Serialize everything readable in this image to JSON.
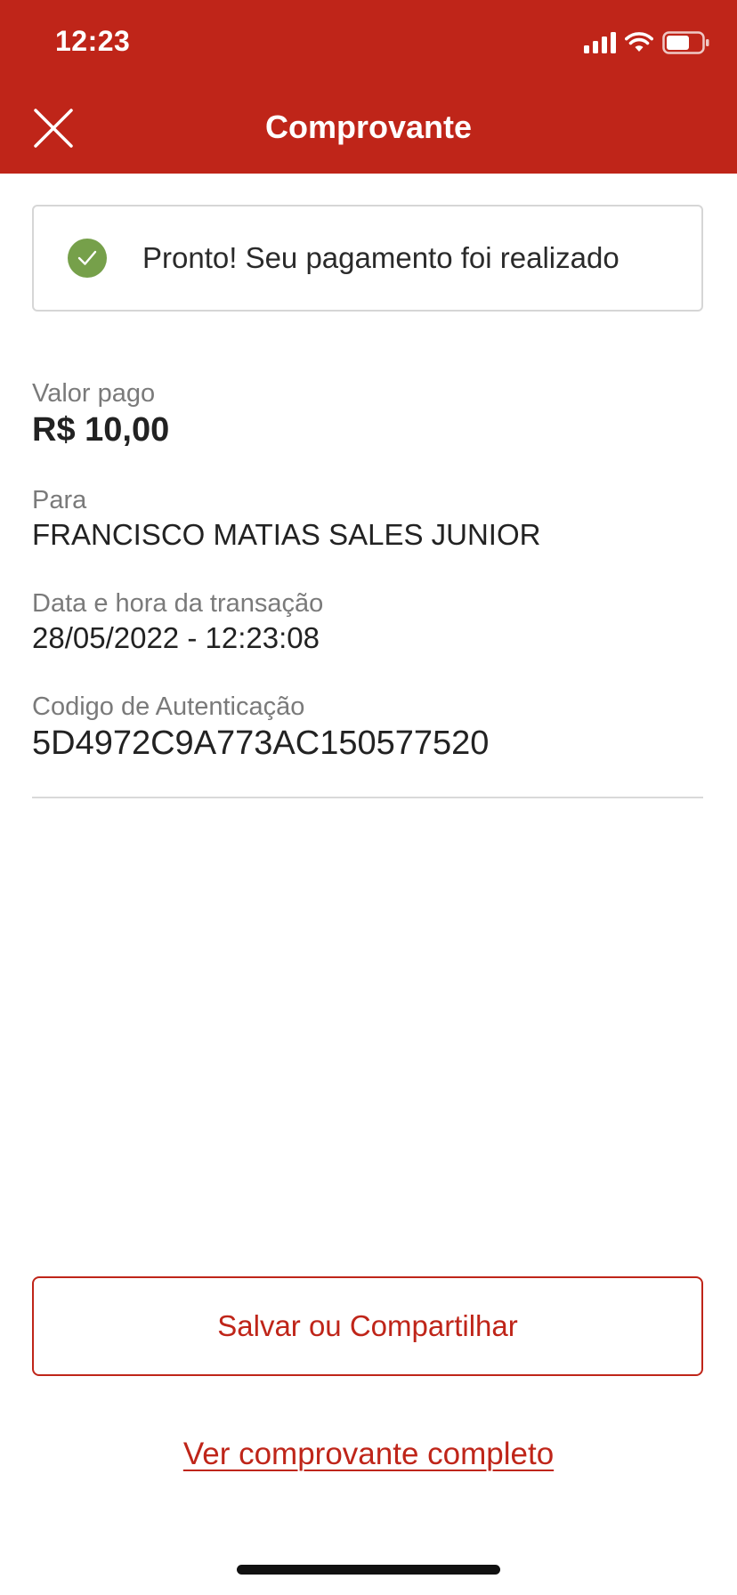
{
  "status_bar": {
    "time": "12:23",
    "icons": [
      "signal-icon",
      "wifi-icon",
      "battery-icon"
    ]
  },
  "nav": {
    "title": "Comprovante",
    "close_icon": "close-icon"
  },
  "success": {
    "icon": "check-circle-icon",
    "message": "Pronto! Seu pagamento foi realizado"
  },
  "details": {
    "amount_label": "Valor pago",
    "amount_value": "R$ 10,00",
    "to_label": "Para",
    "to_value": "FRANCISCO MATIAS SALES JUNIOR",
    "datetime_label": "Data e hora da transação",
    "datetime_value": "28/05/2022 - 12:23:08",
    "auth_label": "Codigo de Autenticação",
    "auth_value": "5D4972C9A773AC150577520"
  },
  "actions": {
    "save_share_label": "Salvar ou Compartilhar",
    "full_receipt_link": "Ver comprovante completo"
  },
  "colors": {
    "brand_red": "#bf2519",
    "success_green": "#76a04a",
    "label_gray": "#7a7a7a",
    "divider_gray": "#d9d9d9"
  }
}
